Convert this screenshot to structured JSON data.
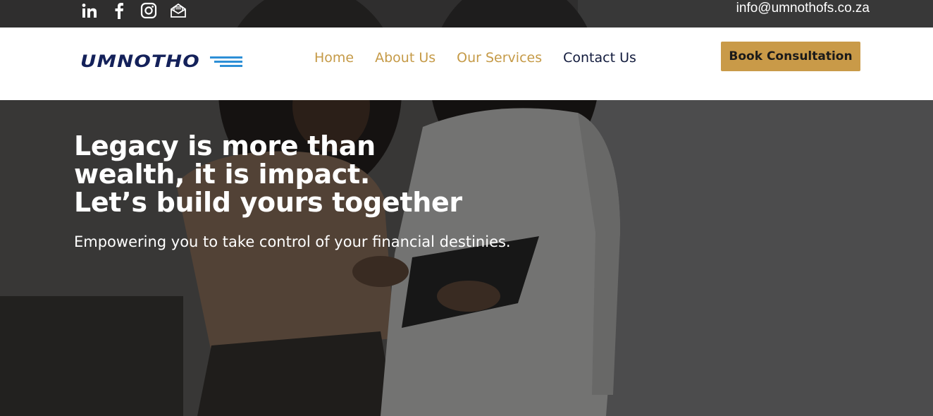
{
  "topbar": {
    "social_icons": [
      "linkedin-icon",
      "facebook-icon",
      "instagram-icon",
      "mail-icon"
    ],
    "email": "info@umnothofs.co.za"
  },
  "header": {
    "logo_text": "UMNOTHO",
    "nav": [
      {
        "label": "Home",
        "active": false
      },
      {
        "label": "About Us",
        "active": false
      },
      {
        "label": "Our Services",
        "active": false
      },
      {
        "label": "Contact Us",
        "active": true
      }
    ],
    "cta_label": "Book Consultation"
  },
  "hero": {
    "title": "Legacy is more than\nwealth, it is impact.\nLet’s build yours together",
    "subtitle": "Empowering you to take control of your financial destinies."
  },
  "colors": {
    "accent_gold": "#c99a48",
    "nav_gold": "#c59a47",
    "navy": "#14215a",
    "logo_blue": "#2d8fd6"
  }
}
